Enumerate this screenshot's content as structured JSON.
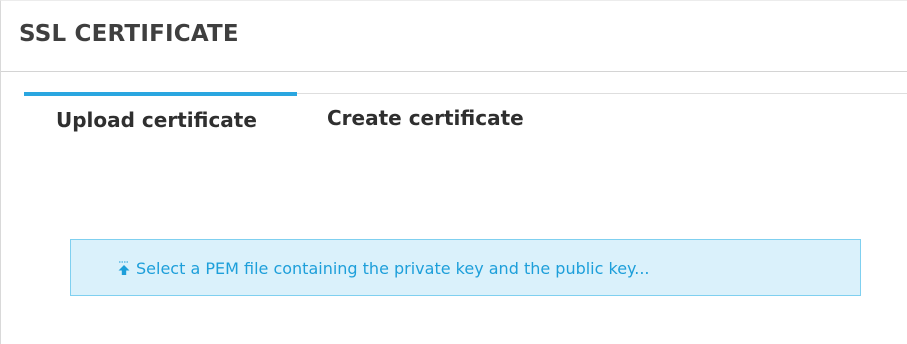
{
  "panel": {
    "title": "SSL CERTIFICATE"
  },
  "tabs": [
    {
      "label": "Upload certificate",
      "active": true
    },
    {
      "label": "Create certificate",
      "active": false
    }
  ],
  "upload": {
    "prompt": "Select a PEM file containing the private key and the public key...",
    "icon": "upload-icon"
  },
  "colors": {
    "accent": "#2aa6e0",
    "upload_bg": "#daf1fb",
    "upload_border": "#7fd0f0",
    "upload_text": "#1d9fda",
    "title_text": "#3f3f3f"
  }
}
